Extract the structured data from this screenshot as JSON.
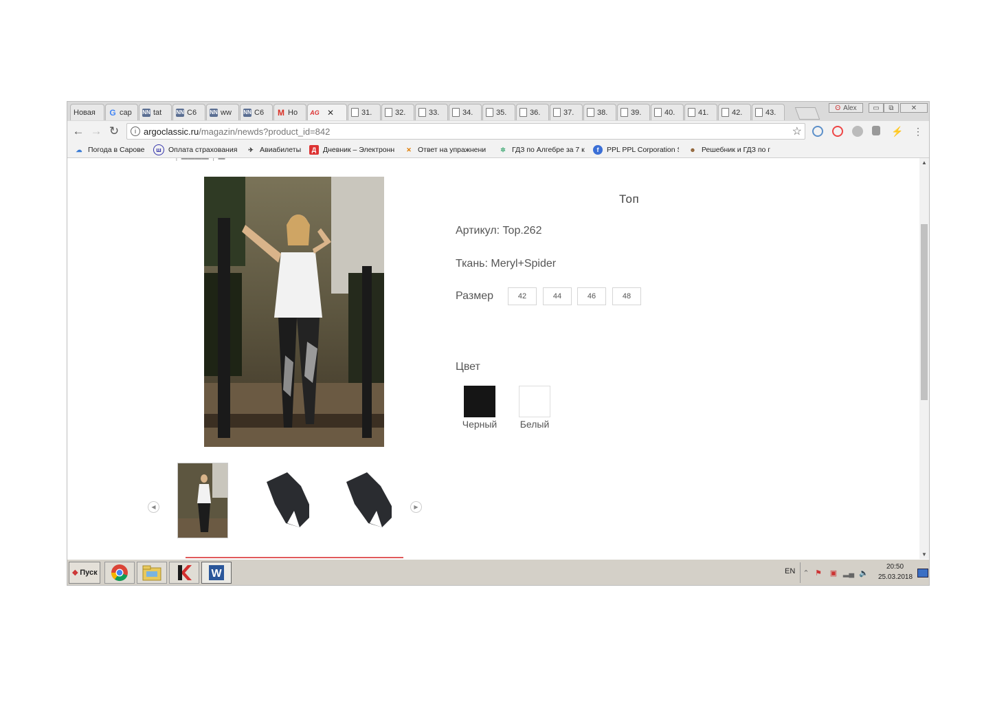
{
  "browser": {
    "tabs": [
      {
        "label": "Новая",
        "favicon": "new-tab-icon"
      },
      {
        "label": "сар",
        "favicon": "google-icon"
      },
      {
        "label": "tat",
        "favicon": "nn-icon"
      },
      {
        "label": "C6",
        "favicon": "nn-icon"
      },
      {
        "label": "ww",
        "favicon": "nn-icon"
      },
      {
        "label": "C6",
        "favicon": "nn-icon"
      },
      {
        "label": "Но",
        "favicon": "gmail-icon"
      },
      {
        "label": "",
        "favicon": "argo-icon",
        "active": true
      },
      {
        "label": "31.",
        "favicon": "document-icon"
      },
      {
        "label": "32.",
        "favicon": "document-icon"
      },
      {
        "label": "33.",
        "favicon": "document-icon"
      },
      {
        "label": "34.",
        "favicon": "document-icon"
      },
      {
        "label": "35.",
        "favicon": "document-icon"
      },
      {
        "label": "36.",
        "favicon": "document-icon"
      },
      {
        "label": "37.",
        "favicon": "document-icon"
      },
      {
        "label": "38.",
        "favicon": "document-icon"
      },
      {
        "label": "39.",
        "favicon": "document-icon"
      },
      {
        "label": "40.",
        "favicon": "document-icon"
      },
      {
        "label": "41.",
        "favicon": "document-icon"
      },
      {
        "label": "42.",
        "favicon": "document-icon"
      },
      {
        "label": "43.",
        "favicon": "document-icon"
      }
    ],
    "profile_label": "Alex",
    "url_domain": "argoclassic.ru",
    "url_path": "/magazin/newds?product_id=842",
    "bookmarks": [
      {
        "label": "Погода в Сарове",
        "icon": "weather-icon"
      },
      {
        "label": "Оплата страхования",
        "icon": "insurance-icon"
      },
      {
        "label": "Авиабилеты",
        "icon": "plane-icon"
      },
      {
        "label": "Дневник – Электронн",
        "icon": "diary-icon"
      },
      {
        "label": "Ответ на упражнени",
        "icon": "answer-icon"
      },
      {
        "label": "ГДЗ по Алгебре за 7 к",
        "icon": "gdz-icon"
      },
      {
        "label": "PPL PPL Corporation S",
        "icon": "ppl-icon"
      },
      {
        "label": "Решебник и ГДЗ по г",
        "icon": "reshebnik-icon"
      }
    ]
  },
  "product": {
    "title": "Топ",
    "article": "Артикул: Top.262",
    "fabric": "Ткань: Meryl+Spider",
    "size_label": "Размер",
    "sizes": [
      "42",
      "44",
      "46",
      "48"
    ],
    "color_label": "Цвет",
    "colors": [
      {
        "name": "Черный",
        "hex": "#151515"
      },
      {
        "name": "Белый",
        "hex": "#ffffff"
      }
    ]
  },
  "taskbar": {
    "start_label": "Пуск",
    "lang": "EN",
    "time": "20:50",
    "date": "25.03.2018"
  }
}
